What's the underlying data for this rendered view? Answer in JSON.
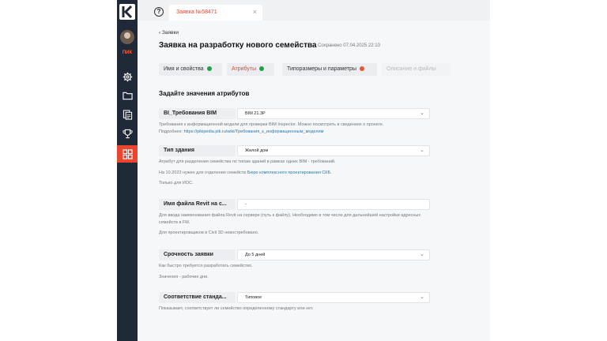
{
  "rail": {
    "brand": "ПИК",
    "accent": "#e8462e",
    "items": [
      {
        "icon": "gear-icon"
      },
      {
        "icon": "folder-icon"
      },
      {
        "icon": "documents-icon"
      },
      {
        "icon": "trophy-icon"
      },
      {
        "icon": "grid-icon",
        "active": true
      }
    ]
  },
  "tab": {
    "label": "Заявка №58471",
    "close": "×"
  },
  "header": {
    "help": "?",
    "back": "‹ Заявки",
    "title": "Заявка на разработку нового семейства",
    "saved": "Сохранено 07.04.2025 22:10"
  },
  "steps": [
    {
      "label": "Имя и свойства",
      "status": "ok"
    },
    {
      "label": "Атрибуты",
      "status": "ok",
      "active": true
    },
    {
      "label": "Типоразмеры и параметры",
      "status": "error"
    },
    {
      "label": "Описание и файлы",
      "status": "disabled"
    }
  ],
  "section_title": "Задайте значения атрибутов",
  "fields": [
    {
      "label": "BI_Требования BIM",
      "value": "BIM 21.3P",
      "dropdown": true,
      "help": [
        {
          "text": "Требования к информационной модели для проверки BIM Inspector. Можно посмотреть в сведениях о проекте."
        },
        {
          "text": "Подробнее: ",
          "link": "https://pikipedia.pik.ru/wiki/Требования_к_информационным_моделям"
        }
      ]
    },
    {
      "label": "Тип здания",
      "value": "Жилой дом",
      "dropdown": true,
      "help": [
        {
          "text": "Атрибут для разделения семейства по типам зданий в рамках одних BIM - требований."
        },
        {
          "text": "На 10.2023 нужен для отделения семейств ",
          "link": "Бюро комплексного проектирования СКБ."
        },
        {
          "text": "Только для ИОС."
        }
      ]
    },
    {
      "label": "Имя файла Revit на с...",
      "value": "-",
      "dropdown": false,
      "help": [
        {
          "text": "Для ввода наименования файла Revit на сервере (путь к файлу). Необходимо в том числе для дальнейшей настройки адресных семейств в FM."
        },
        {
          "text": "Для проектировщиков в Civil 3D невостребовано."
        }
      ]
    },
    {
      "label": "Срочность заявки",
      "value": "До 5 дней",
      "dropdown": true,
      "help": [
        {
          "text": "Как быстро требуется разработать семейство."
        },
        {
          "text": "Значения - рабочие дни."
        }
      ]
    },
    {
      "label": "Соответствие станда...",
      "value": "Типовое",
      "dropdown": true,
      "help": [
        {
          "text": "Показывает, соответствует ли семейство определенному стандарту или нет."
        }
      ]
    }
  ],
  "colors": {
    "ok": "#1ea446",
    "error": "#e2572f",
    "accent": "#e8462e",
    "link": "#2a7ab0"
  }
}
